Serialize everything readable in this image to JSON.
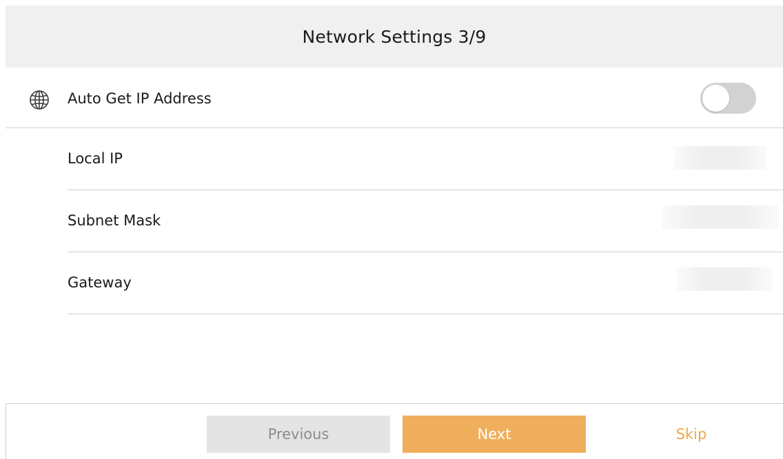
{
  "header": {
    "title": "Network Settings 3/9"
  },
  "auto_ip": {
    "label": "Auto Get IP Address",
    "icon": "globe-icon",
    "enabled": false
  },
  "fields": {
    "local_ip": {
      "label": "Local IP",
      "value": ""
    },
    "subnet_mask": {
      "label": "Subnet Mask",
      "value": ""
    },
    "gateway": {
      "label": "Gateway",
      "value": ""
    }
  },
  "footer": {
    "previous_label": "Previous",
    "next_label": "Next",
    "skip_label": "Skip"
  },
  "colors": {
    "accent": "#f0af5c",
    "skip_text": "#f0a845",
    "header_bg": "#f0f0f0",
    "toggle_off": "#d2d2d2",
    "disabled_button": "#e4e4e4"
  }
}
